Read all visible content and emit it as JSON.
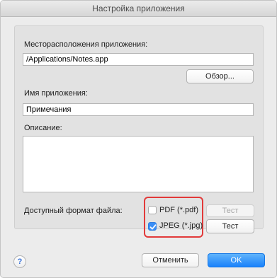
{
  "window": {
    "title": "Настройка приложения"
  },
  "app_location": {
    "label": "Месторасположения приложения:",
    "value": "/Applications/Notes.app",
    "browse_label": "Обзор..."
  },
  "app_name": {
    "label": "Имя приложения:",
    "value": "Примечания"
  },
  "description": {
    "label": "Описание:",
    "value": ""
  },
  "formats": {
    "label": "Доступный формат файла:",
    "items": [
      {
        "label": "PDF (*.pdf)",
        "checked": false,
        "test_label": "Тест",
        "test_enabled": false
      },
      {
        "label": "JPEG (*.jpg)",
        "checked": true,
        "test_label": "Тест",
        "test_enabled": true
      }
    ]
  },
  "footer": {
    "help_label": "?",
    "cancel_label": "Отменить",
    "ok_label": "OK"
  },
  "colors": {
    "accent": "#1a82fb",
    "highlight": "#e23a3a",
    "window_bg": "#ececec"
  },
  "icons": {
    "help": "question-mark-icon",
    "checkmark": "checkmark-icon"
  }
}
